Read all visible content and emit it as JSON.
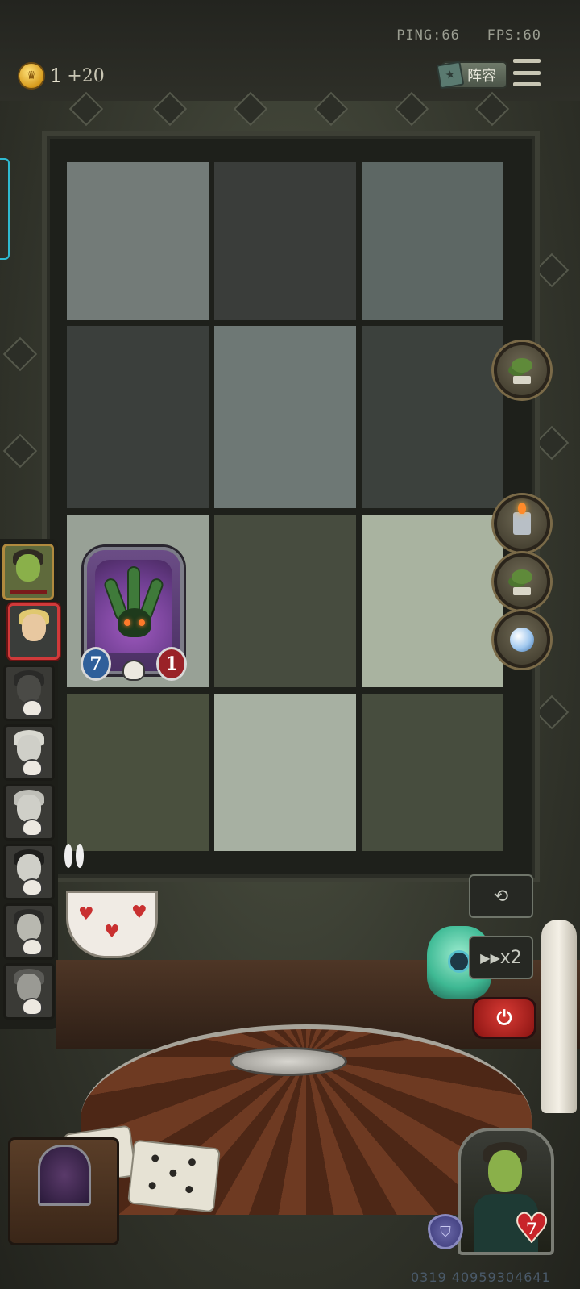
{
  "status": {
    "ping": "PING:66",
    "fps": "FPS:60"
  },
  "gold": {
    "count": "1",
    "income": "+20",
    "icon": "crown-coin-icon"
  },
  "toolbar": {
    "lineup_label": "阵容",
    "menu_icon": "hamburger-menu-icon"
  },
  "board": {
    "rows": 4,
    "cols": 3,
    "unit": {
      "attack": "7",
      "health": "1",
      "name": "tentacle-monster"
    }
  },
  "items": [
    {
      "name": "bonsai-tree-icon"
    },
    {
      "name": "lighter-icon"
    },
    {
      "name": "bonsai-tree-icon"
    },
    {
      "name": "crystal-orb-icon"
    }
  ],
  "roster": [
    {
      "state": "alive",
      "portrait": "goblin-monocle-portrait"
    },
    {
      "state": "current",
      "portrait": "masked-blonde-portrait"
    },
    {
      "state": "eliminated",
      "portrait": "hooded-assassin-portrait"
    },
    {
      "state": "eliminated",
      "portrait": "long-hair-woman-portrait"
    },
    {
      "state": "eliminated",
      "portrait": "beast-portrait"
    },
    {
      "state": "eliminated",
      "portrait": "tophat-man-portrait"
    },
    {
      "state": "eliminated",
      "portrait": "dark-hair-woman-portrait"
    },
    {
      "state": "eliminated",
      "portrait": "wolf-portrait"
    }
  ],
  "controls": {
    "undo_icon": "undo-icon",
    "speed_label": "x2",
    "speed_icon": "fast-forward-icon",
    "power_icon": "power-icon"
  },
  "player": {
    "health": "7",
    "shield_icon": "shield-icon"
  },
  "match_id": "0319 40959304641"
}
